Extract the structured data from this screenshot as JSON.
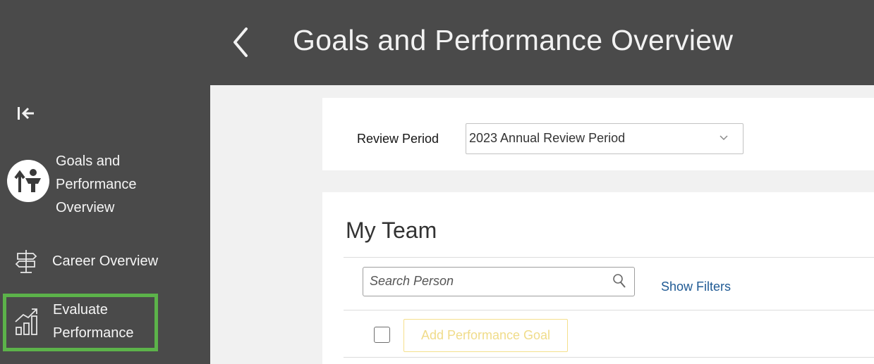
{
  "header": {
    "title": "Goals and Performance Overview",
    "back_icon": "chevron-left-icon"
  },
  "sidebar": {
    "collapse_icon": "collapse-left-icon",
    "items": [
      {
        "label": "Goals and Performance Overview",
        "icon": "goals-performance-icon",
        "selected": true
      },
      {
        "label": "Career Overview",
        "icon": "signpost-icon"
      },
      {
        "label": "Evaluate Performance",
        "icon": "growth-chart-icon",
        "highlighted": true
      }
    ]
  },
  "review_period": {
    "label": "Review Period",
    "value": "2023 Annual Review Period"
  },
  "team": {
    "title": "My Team",
    "search": {
      "placeholder": "Search Person"
    },
    "show_filters": "Show Filters",
    "add_goal": "Add Performance Goal"
  },
  "colors": {
    "header_bg": "#4a4a4a",
    "content_bg": "#f1f1f1",
    "highlight": "#5cb34a",
    "link": "#1f5a94",
    "disabled_button_text": "#f0dc8a"
  }
}
